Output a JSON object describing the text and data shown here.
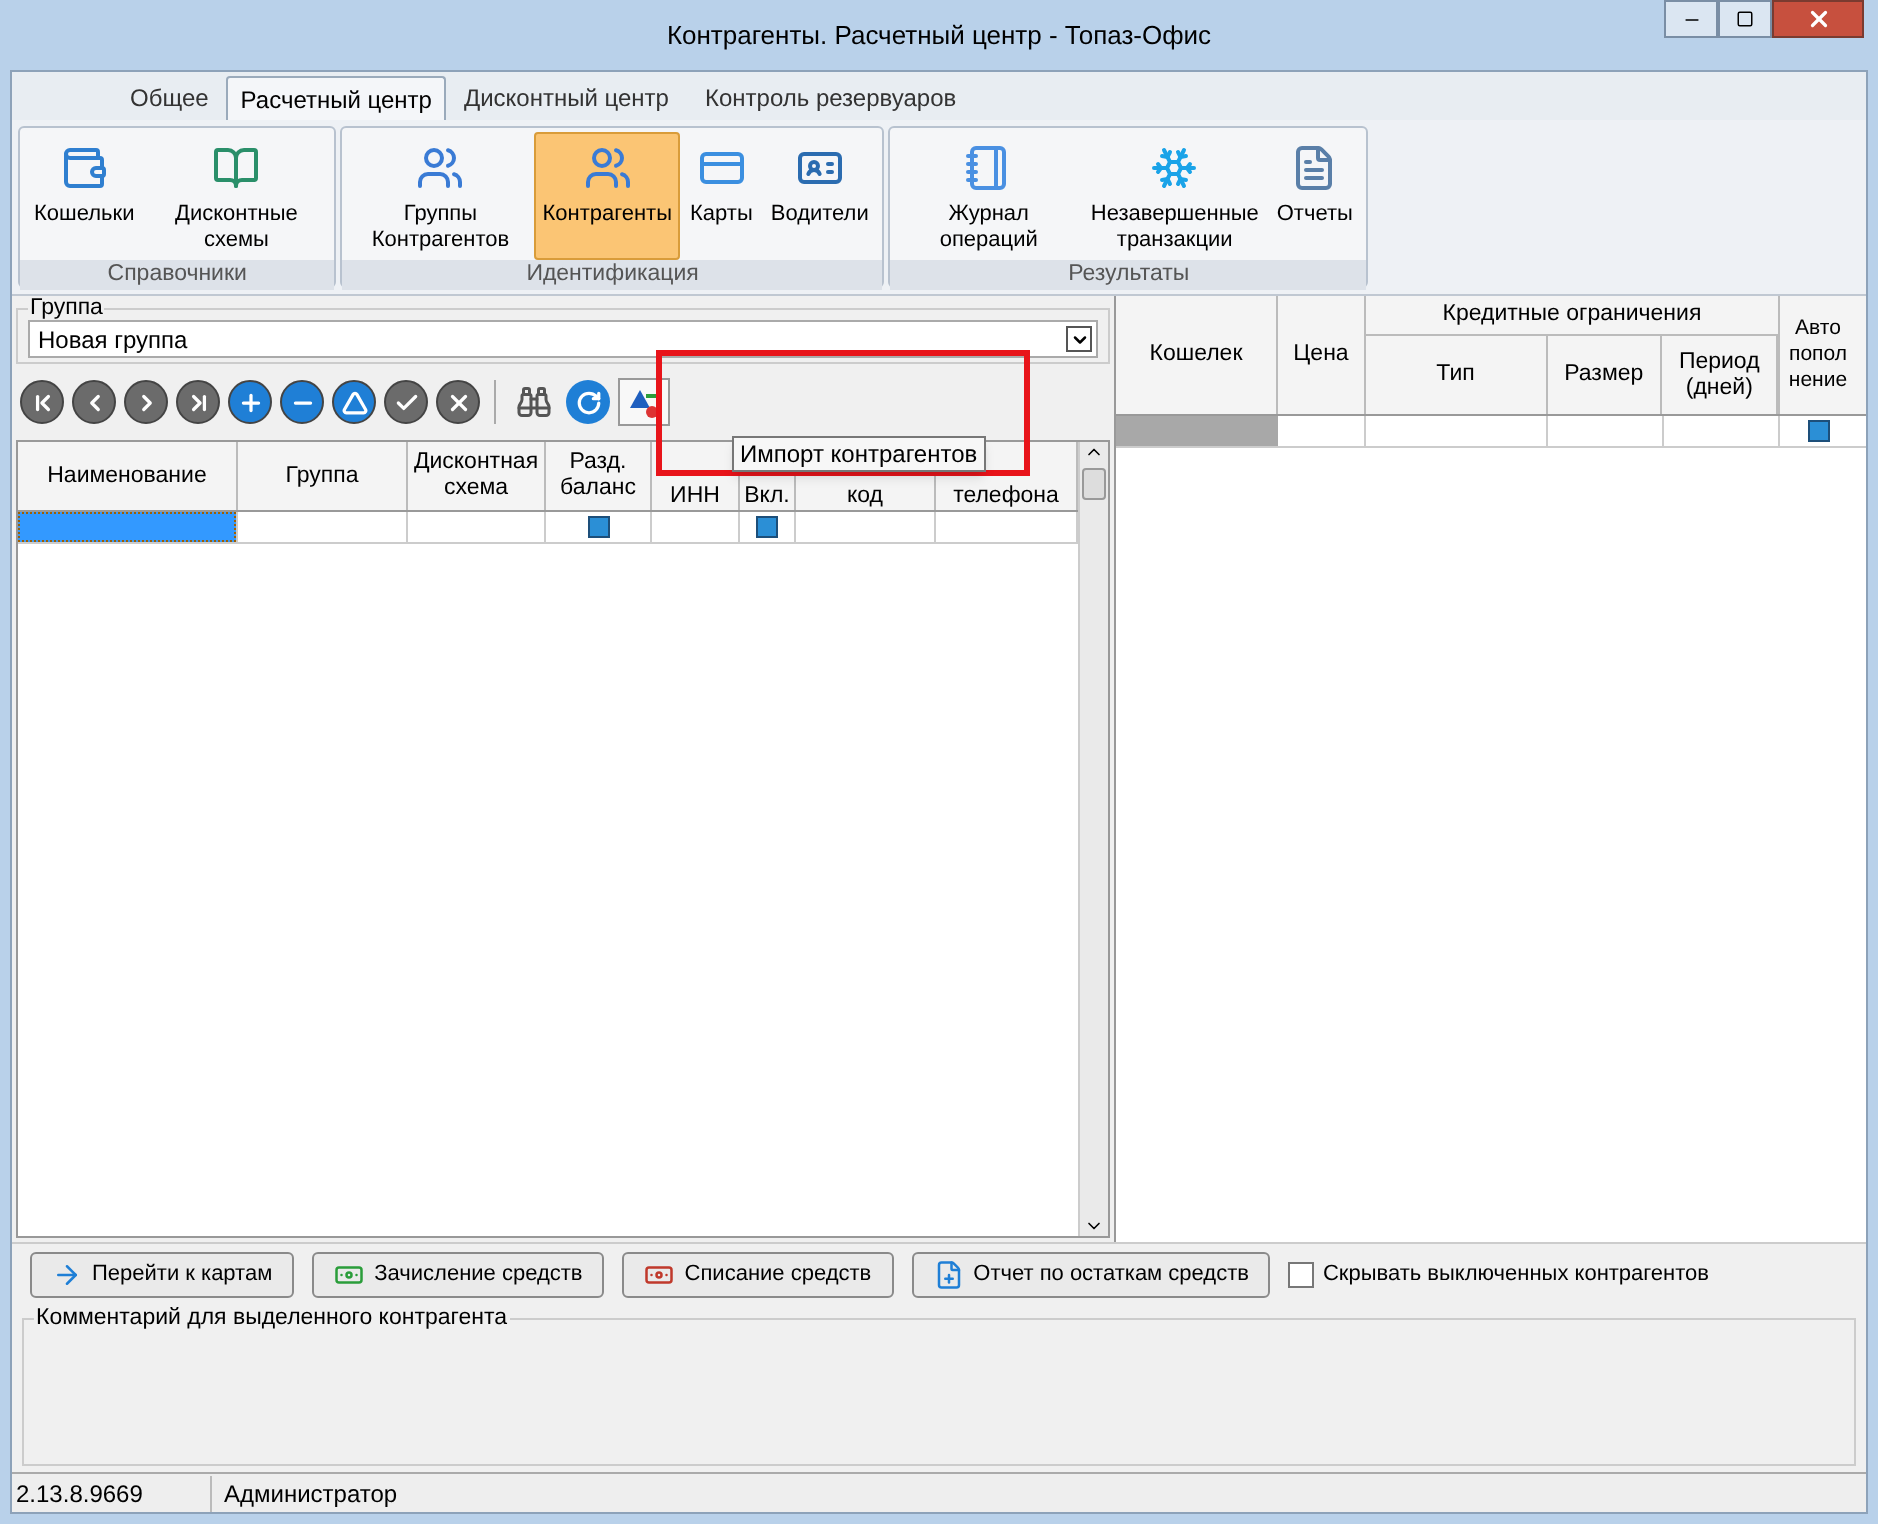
{
  "window": {
    "title": "Контрагенты. Расчетный центр - Топаз-Офис"
  },
  "tabs": [
    {
      "label": "Общее",
      "selected": false
    },
    {
      "label": "Расчетный центр",
      "selected": true
    },
    {
      "label": "Дисконтный центр",
      "selected": false
    },
    {
      "label": "Контроль резервуаров",
      "selected": false
    }
  ],
  "ribbon": [
    {
      "label": "Справочники",
      "items": [
        {
          "label": "Кошельки",
          "selected": false
        },
        {
          "label": "Дисконтные схемы",
          "selected": false
        }
      ]
    },
    {
      "label": "Идентификация",
      "items": [
        {
          "label": "Группы Контрагентов",
          "selected": false
        },
        {
          "label": "Контрагенты",
          "selected": true
        },
        {
          "label": "Карты",
          "selected": false
        },
        {
          "label": "Водители",
          "selected": false
        }
      ]
    },
    {
      "label": "Результаты",
      "items": [
        {
          "label": "Журнал операций",
          "selected": false
        },
        {
          "label": "Незавершенные транзакции",
          "selected": false
        },
        {
          "label": "Отчеты",
          "selected": false
        }
      ]
    }
  ],
  "group_field": {
    "label": "Группа",
    "value": "Новая группа"
  },
  "tooltip": "Импорт контрагентов",
  "left_table": {
    "columns": [
      "Наименование",
      "Группа",
      "Дисконтная схема",
      "Разд. баланс",
      "ИНН",
      "Вкл.",
      "код",
      "телефона"
    ],
    "rows": [
      {
        "selected": true,
        "cells": [
          {
            "kind": "text"
          },
          {
            "kind": "text"
          },
          {
            "kind": "text"
          },
          {
            "kind": "check",
            "checked": true
          },
          {
            "kind": "text"
          },
          {
            "kind": "check",
            "checked": true
          },
          {
            "kind": "text"
          },
          {
            "kind": "text"
          }
        ]
      }
    ]
  },
  "right_table": {
    "columns": [
      "Кошелек",
      "Цена"
    ],
    "group": {
      "label": "Кредитные ограничения",
      "columns": [
        "Тип",
        "Размер",
        "Период (дней)"
      ]
    },
    "last_column": "Авто попол нение",
    "rows": [
      {
        "selected": true,
        "auto_checked": true
      }
    ]
  },
  "buttons": [
    "Перейти к картам",
    "Зачисление средств",
    "Списание средств",
    "Отчет по остаткам средств"
  ],
  "hide_disabled": {
    "label": "Скрывать выключенных контрагентов",
    "checked": false
  },
  "comment_group": {
    "label": "Комментарий для выделенного контрагента"
  },
  "status_bar": {
    "version": "2.13.8.9669",
    "user": "Администратор"
  }
}
